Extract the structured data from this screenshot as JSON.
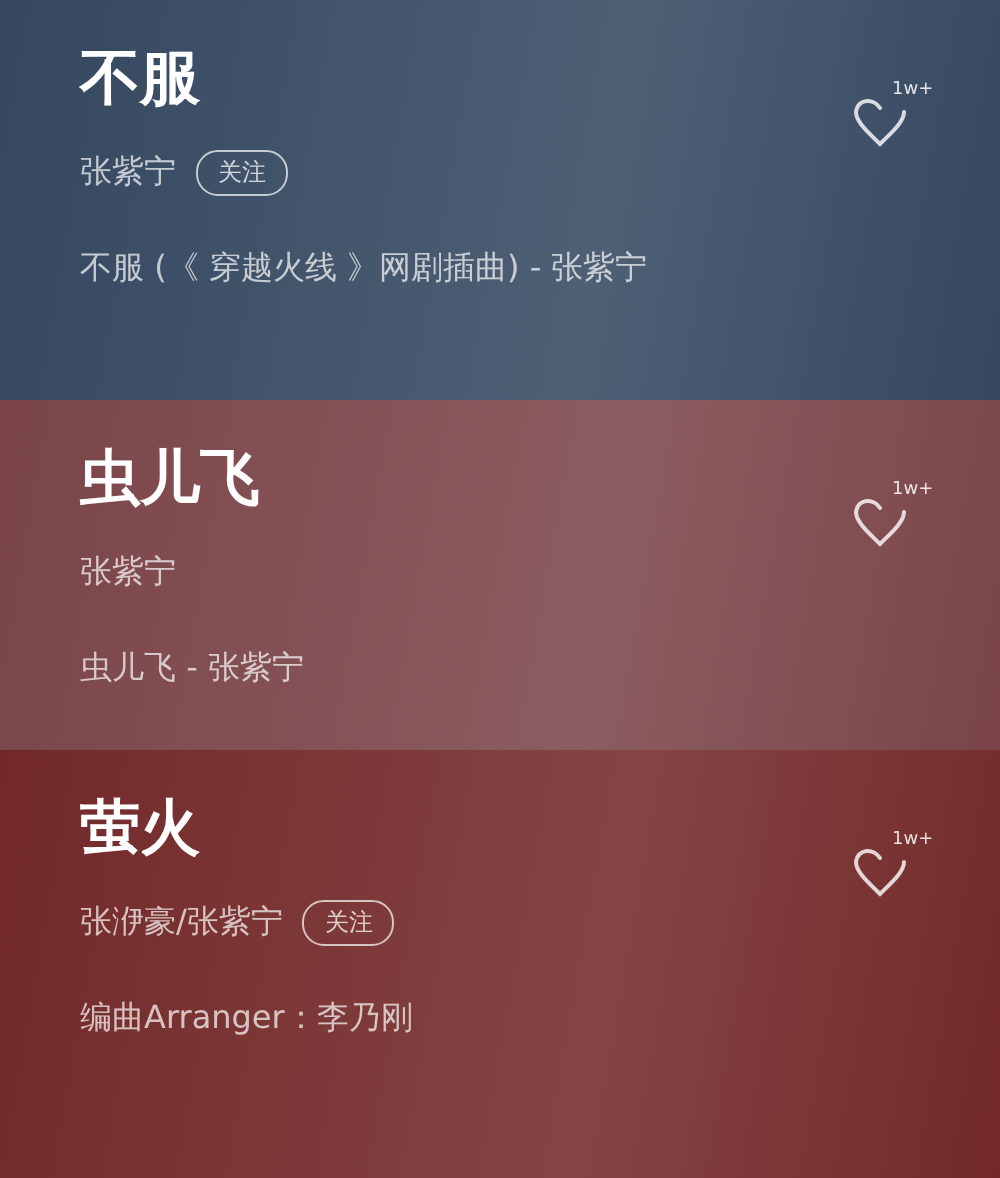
{
  "songs": [
    {
      "title": "不服",
      "artist": "张紫宁",
      "follow": "关注",
      "line": "不服 (《 穿越火线 》网剧插曲) - 张紫宁",
      "likes": "1w+",
      "color": "#34475f"
    },
    {
      "title": "虫儿飞",
      "artist": "张紫宁",
      "line": "虫儿飞 - 张紫宁",
      "likes": "1w+",
      "color": "#7a4448"
    },
    {
      "title": "萤火",
      "artist": "张洢豪/张紫宁",
      "follow": "关注",
      "line": "编曲Arranger：李乃刚",
      "likes": "1w+",
      "color": "#722828"
    }
  ]
}
